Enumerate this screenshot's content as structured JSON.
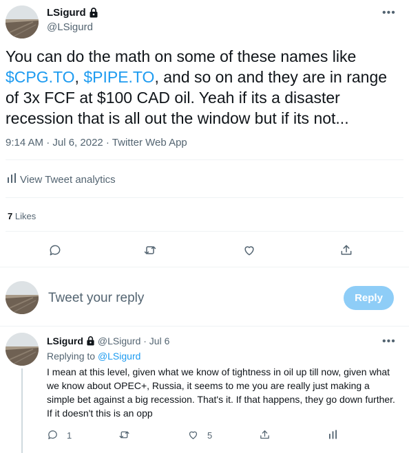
{
  "tweet": {
    "display_name": "LSigurd",
    "handle": "@LSigurd",
    "text_parts": [
      {
        "text": "You can do the math on some of these names like ",
        "cashtag": false
      },
      {
        "text": "$CPG.TO",
        "cashtag": true
      },
      {
        "text": ", ",
        "cashtag": false
      },
      {
        "text": "$PIPE.TO",
        "cashtag": true
      },
      {
        "text": ", and so on and they are in range of 3x FCF at $100 CAD oil.  Yeah if its a disaster recession that is all out the window but if its not...",
        "cashtag": false
      }
    ],
    "timestamp": "9:14 AM · Jul 6, 2022 · Twitter Web App",
    "analytics_label": "View Tweet analytics",
    "likes_count": "7",
    "likes_label": "Likes"
  },
  "reply_composer": {
    "placeholder": "Tweet your reply",
    "button_label": "Reply"
  },
  "reply_tweet": {
    "display_name": "LSigurd",
    "handle_time": "@LSigurd · Jul 6",
    "replying_prefix": "Replying to ",
    "replying_to": "@LSigurd",
    "body": "I mean at this level, given what we know of tightness in oil up till now, given what we know about OPEC+, Russia, it seems to me you are really just making a simple bet against a big recession.  That's it.  If that happens, they go down further.  If it doesn't this is an opp",
    "reply_count": "1",
    "like_count": "5"
  },
  "colors": {
    "text": "#0f1419",
    "secondary": "#536471",
    "accent": "#1d9bf0",
    "reply_button_disabled": "#8ecdf7",
    "divider": "#eff3f4"
  }
}
